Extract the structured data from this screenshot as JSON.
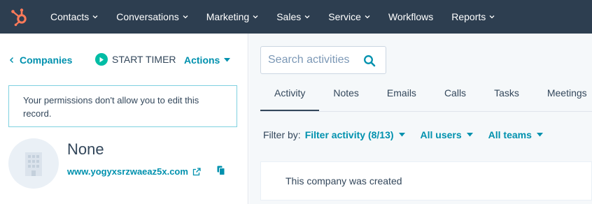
{
  "nav": {
    "items": [
      {
        "label": "Contacts",
        "has_dropdown": true
      },
      {
        "label": "Conversations",
        "has_dropdown": true
      },
      {
        "label": "Marketing",
        "has_dropdown": true
      },
      {
        "label": "Sales",
        "has_dropdown": true
      },
      {
        "label": "Service",
        "has_dropdown": true
      },
      {
        "label": "Workflows",
        "has_dropdown": false
      },
      {
        "label": "Reports",
        "has_dropdown": true
      }
    ]
  },
  "left": {
    "back_label": "Companies",
    "timer_label": "START TIMER",
    "actions_label": "Actions",
    "alert_text": "Your permissions don't allow you to edit this record.",
    "company_name": "None",
    "domain": "www.yogyxsrzwaeaz5x.com"
  },
  "right": {
    "search_placeholder": "Search activities",
    "tabs": [
      "Activity",
      "Notes",
      "Emails",
      "Calls",
      "Tasks",
      "Meetings"
    ],
    "active_tab": "Activity",
    "filter_label": "Filter by:",
    "filters": [
      "Filter activity (8/13)",
      "All users",
      "All teams"
    ],
    "activity_text": "This company was created"
  },
  "colors": {
    "nav_bg": "#2d3e50",
    "accent": "#0091ae",
    "brand_orange": "#ff7a59",
    "timer_green": "#00bda5"
  }
}
